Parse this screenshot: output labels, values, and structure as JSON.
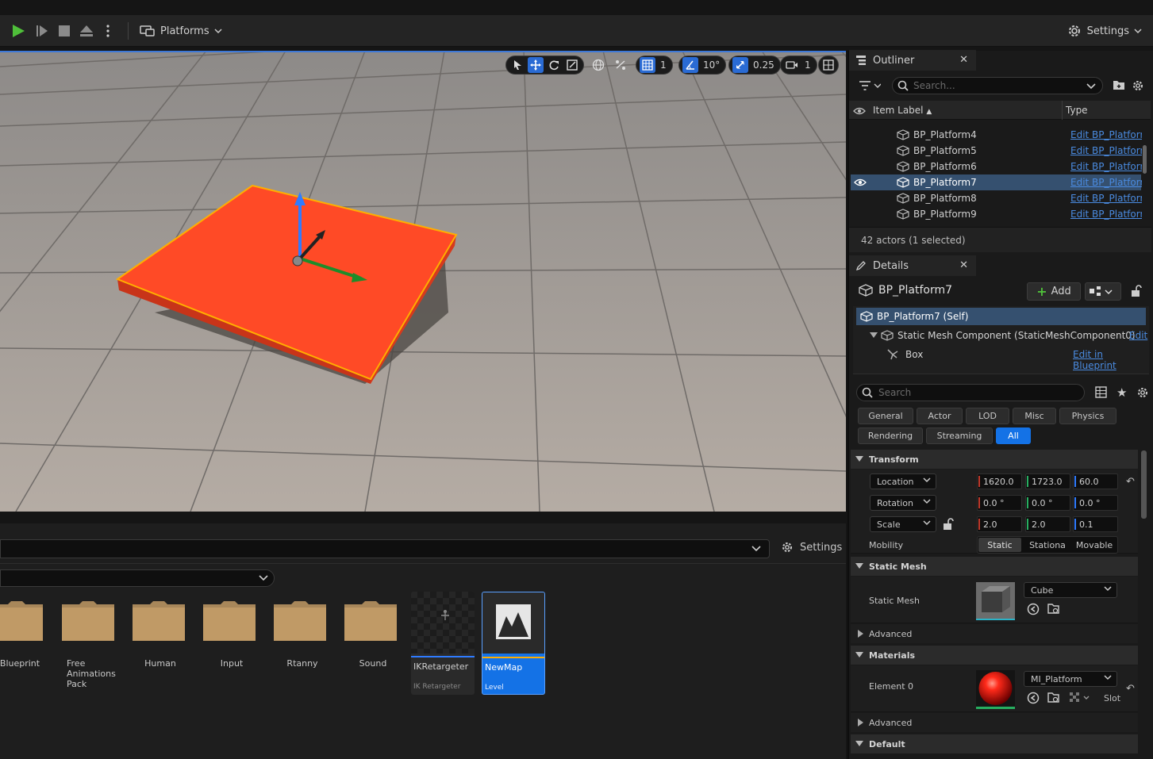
{
  "toolbar": {
    "platforms_label": "Platforms",
    "settings_label": "Settings"
  },
  "viewport": {
    "grid_snap": "1",
    "rotation_snap": "10°",
    "scale_snap": "0.25",
    "camera_speed": "1"
  },
  "content_browser": {
    "settings_label": "Settings",
    "folders": [
      {
        "label": "Blueprint"
      },
      {
        "label": "Free Animations Pack"
      },
      {
        "label": "Human"
      },
      {
        "label": "Input"
      },
      {
        "label": "Rtanny"
      },
      {
        "label": "Sound"
      }
    ],
    "assets": [
      {
        "name": "IKRetargeter",
        "kind": "IK Retargeter"
      },
      {
        "name": "NewMap",
        "kind": "Level"
      }
    ]
  },
  "outliner": {
    "title": "Outliner",
    "search_placeholder": "Search...",
    "col_label": "Item Label",
    "col_type": "Type",
    "rows": [
      {
        "name": "BP_Platform4",
        "type": "Edit BP_Platform"
      },
      {
        "name": "BP_Platform5",
        "type": "Edit BP_Platform"
      },
      {
        "name": "BP_Platform6",
        "type": "Edit BP_Platform"
      },
      {
        "name": "BP_Platform7",
        "type": "Edit BP_Platform"
      },
      {
        "name": "BP_Platform8",
        "type": "Edit BP_Platform"
      },
      {
        "name": "BP_Platform9",
        "type": "Edit BP_Platform"
      }
    ],
    "status": "42 actors (1 selected)"
  },
  "details": {
    "title": "Details",
    "actor_name": "BP_Platform7",
    "add_label": "Add",
    "components": {
      "self": "BP_Platform7 (Self)",
      "static_mesh": "Static Mesh Component (StaticMeshComponent0)",
      "static_mesh_edit": "Edit",
      "box": "Box",
      "box_edit": "Edit in Blueprint"
    },
    "search_placeholder": "Search",
    "filters": [
      "General",
      "Actor",
      "LOD",
      "Misc",
      "Physics",
      "Rendering",
      "Streaming",
      "All"
    ],
    "active_filter": "All",
    "transform": {
      "title": "Transform",
      "location_label": "Location",
      "rotation_label": "Rotation",
      "scale_label": "Scale",
      "location": [
        "1620.0",
        "1723.0",
        "60.0"
      ],
      "rotation": [
        "0.0 °",
        "0.0 °",
        "0.0 °"
      ],
      "scale": [
        "2.0",
        "2.0",
        "0.1"
      ],
      "mobility_label": "Mobility",
      "mobility_options": [
        "Static",
        "Stationa",
        "Movable"
      ],
      "mobility_selected": "Static"
    },
    "static_mesh": {
      "title": "Static Mesh",
      "label": "Static Mesh",
      "value": "Cube",
      "advanced": "Advanced"
    },
    "materials": {
      "title": "Materials",
      "element_label": "Element 0",
      "value": "MI_Platform",
      "slot": "Slot",
      "advanced": "Advanced"
    },
    "default_title": "Default"
  },
  "colors": {
    "accent": "#1472e6",
    "platform": "#ff4a26",
    "selection_outline": "#ffae00",
    "link": "#4a8be0"
  }
}
